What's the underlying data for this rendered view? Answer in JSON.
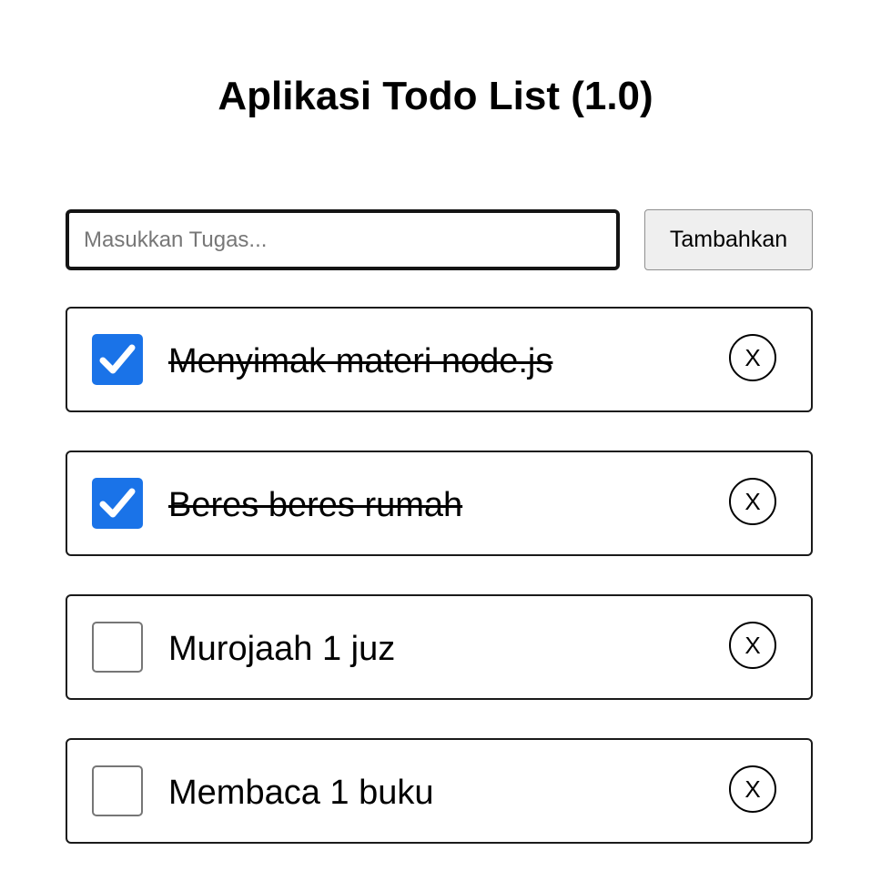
{
  "header": {
    "title": "Aplikasi Todo List (1.0)"
  },
  "form": {
    "input_value": "",
    "input_placeholder": "Masukkan Tugas...",
    "add_label": "Tambahkan"
  },
  "todos": [
    {
      "text": "Menyimak materi node.js",
      "done": true,
      "delete_label": "X"
    },
    {
      "text": "Beres beres rumah",
      "done": true,
      "delete_label": "X"
    },
    {
      "text": "Murojaah 1 juz",
      "done": false,
      "delete_label": "X"
    },
    {
      "text": "Membaca 1 buku",
      "done": false,
      "delete_label": "X"
    }
  ],
  "colors": {
    "checkbox_checked": "#1a73e8",
    "input_border": "#141414",
    "button_background": "#efefef"
  },
  "icons": {
    "checked": "checkmark-icon",
    "delete": "close-icon"
  }
}
